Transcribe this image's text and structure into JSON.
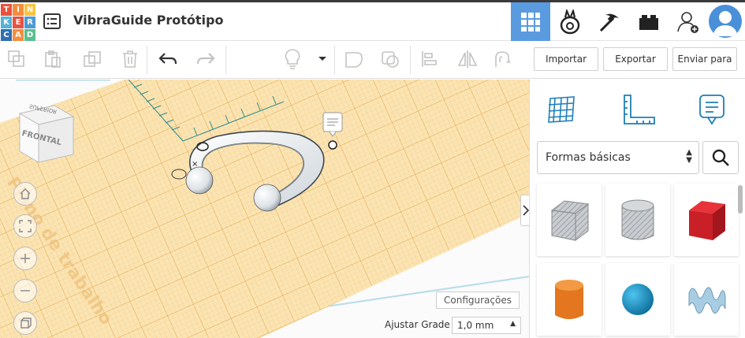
{
  "app": {
    "logo_letters": [
      "T",
      "I",
      "N",
      "K",
      "E",
      "R",
      "C",
      "A",
      "D"
    ],
    "logo_colors": [
      "#e8523f",
      "#f58d3f",
      "#f9c33f",
      "#53b3d8",
      "#e8523f",
      "#4b9ad6",
      "#2f6fb2",
      "#f58d3f",
      "#5bbf8f"
    ],
    "document_title": "VibraGuide Protótipo",
    "accent": "#5a9be0"
  },
  "topnav": {
    "icons": [
      "grid-view-icon",
      "codeblocks-icon",
      "sim-lab-icon",
      "bricks-icon",
      "add-user-icon"
    ]
  },
  "toolbar": {
    "import_label": "Importar",
    "export_label": "Exportar",
    "send_label": "Enviar para"
  },
  "viewcube": {
    "front_label": "FRONTAL",
    "top_label": "SUPERIOR"
  },
  "workplane": {
    "watermark": "Plano de trabalho",
    "settings_label": "Configurações",
    "grid_label": "Ajustar Grade",
    "grid_value": "1,0 mm"
  },
  "panel": {
    "category": "Formas básicas",
    "shapes": [
      "box-striped",
      "cylinder-striped",
      "box",
      "cylinder",
      "sphere",
      "scribble"
    ]
  }
}
